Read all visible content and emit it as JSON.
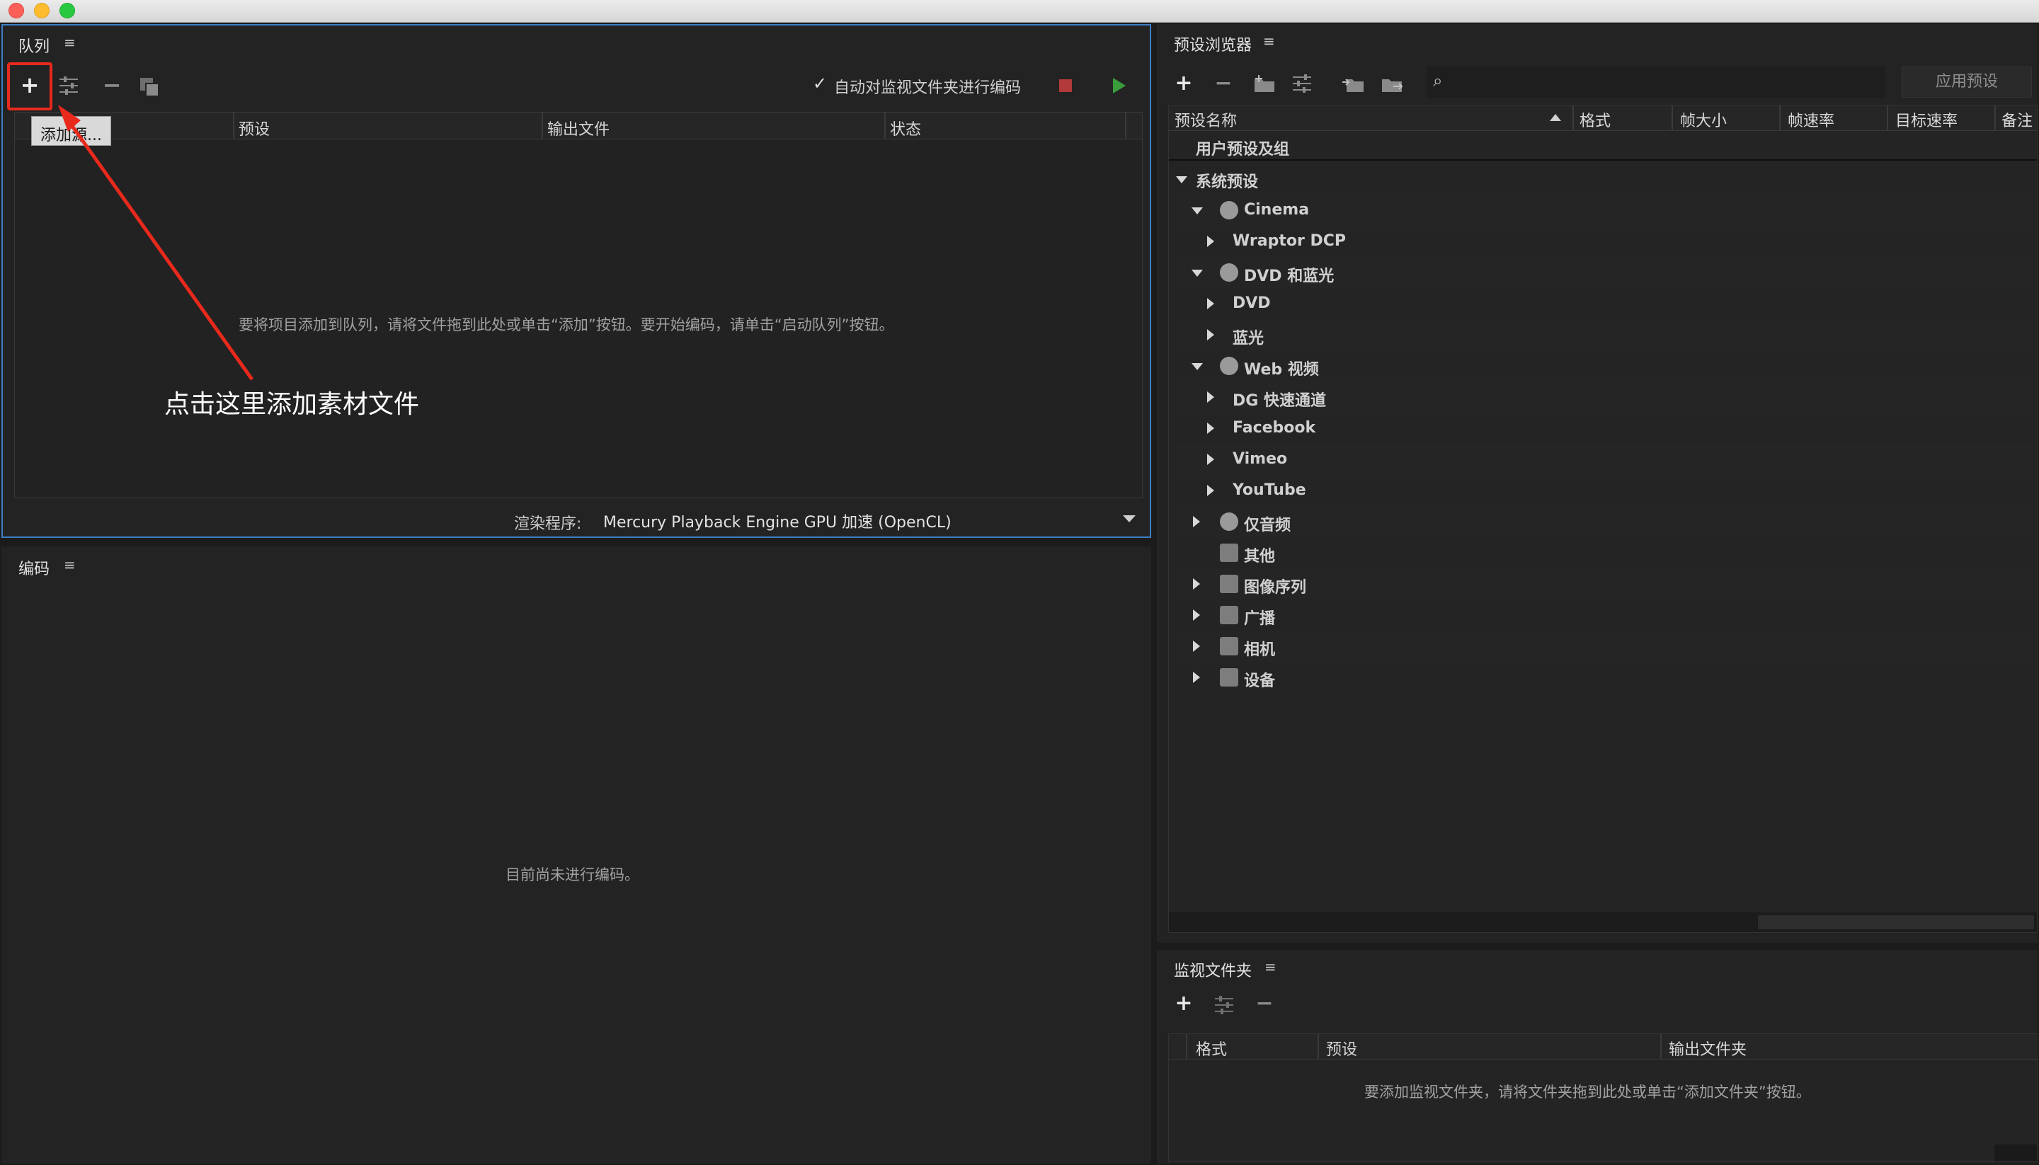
{
  "queue": {
    "title": "队列",
    "menu_icon": "hamburger-icon",
    "watch_checkbox_label": "自动对监视文件夹进行编码",
    "watch_checked": true,
    "tooltip": "添加源...",
    "columns": [
      "预设",
      "输出文件",
      "状态"
    ],
    "empty_hint": "要将项目添加到队列，请将文件拖到此处或单击“添加”按钮。要开始编码，请单击“启动队列”按钮。",
    "renderer_label": "渲染程序:",
    "renderer_value": "Mercury Playback Engine GPU 加速 (OpenCL)"
  },
  "annotation": {
    "text": "点击这里添加素材文件",
    "color": "#e8291c"
  },
  "encode": {
    "title": "编码",
    "empty_hint": "目前尚未进行编码。"
  },
  "preset_browser": {
    "title": "预设浏览器",
    "apply_button": "应用预设",
    "columns": [
      "预设名称",
      "格式",
      "帧大小",
      "帧速率",
      "目标速率",
      "备注"
    ],
    "user_group": "用户预设及组",
    "system_group": "系统预设",
    "tree": [
      {
        "label": "Cinema",
        "level": 1,
        "state": "open",
        "icon": "cinema-icon"
      },
      {
        "label": "Wraptor DCP",
        "level": 2,
        "state": "closed"
      },
      {
        "label": "DVD 和蓝光",
        "level": 1,
        "state": "open",
        "icon": "disc-icon"
      },
      {
        "label": "DVD",
        "level": 2,
        "state": "closed"
      },
      {
        "label": "蓝光",
        "level": 2,
        "state": "closed"
      },
      {
        "label": "Web 视频",
        "level": 1,
        "state": "open",
        "icon": "globe-icon"
      },
      {
        "label": "DG 快速通道",
        "level": 2,
        "state": "closed"
      },
      {
        "label": "Facebook",
        "level": 2,
        "state": "closed"
      },
      {
        "label": "Vimeo",
        "level": 2,
        "state": "closed"
      },
      {
        "label": "YouTube",
        "level": 2,
        "state": "closed"
      },
      {
        "label": "仅音频",
        "level": 0,
        "state": "closed",
        "icon": "speaker-icon"
      },
      {
        "label": "其他",
        "level": 0,
        "state": "none",
        "icon": "monitor-icon"
      },
      {
        "label": "图像序列",
        "level": 0,
        "state": "closed",
        "icon": "film-icon"
      },
      {
        "label": "广播",
        "level": 0,
        "state": "closed",
        "icon": "tv-icon"
      },
      {
        "label": "相机",
        "level": 0,
        "state": "closed",
        "icon": "camera-icon"
      },
      {
        "label": "设备",
        "level": 0,
        "state": "closed",
        "icon": "phone-icon"
      }
    ]
  },
  "watch_folders": {
    "title": "监视文件夹",
    "columns": [
      "格式",
      "预设",
      "输出文件夹"
    ],
    "empty_hint": "要添加监视文件夹，请将文件夹拖到此处或单击“添加文件夹”按钮。"
  }
}
